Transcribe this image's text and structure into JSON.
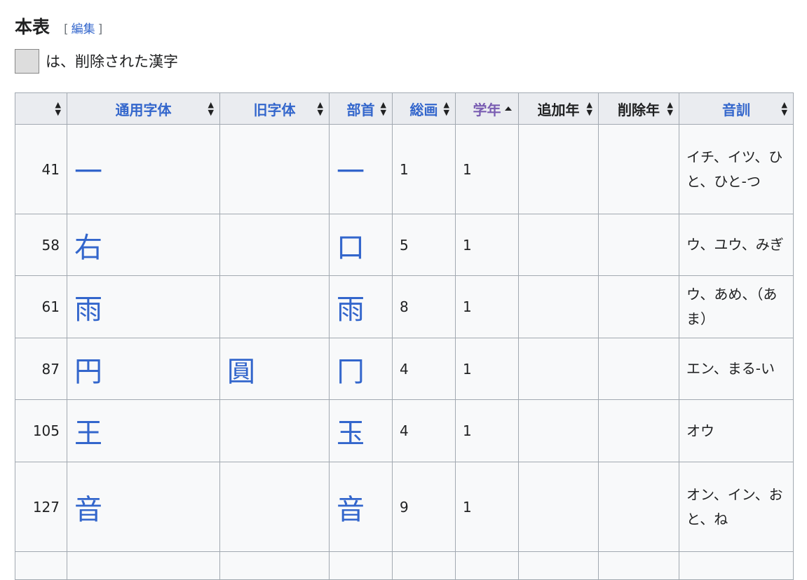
{
  "section": {
    "title": "本表",
    "edit_open": "[",
    "edit_label": "編集",
    "edit_close": "]"
  },
  "legend": {
    "text": "は、削除された漢字",
    "swatch_color": "#dddddd"
  },
  "table": {
    "columns": [
      {
        "label": "",
        "style": "none"
      },
      {
        "label": "通用字体",
        "style": "link"
      },
      {
        "label": "旧字体",
        "style": "link"
      },
      {
        "label": "部首",
        "style": "link"
      },
      {
        "label": "総画",
        "style": "link"
      },
      {
        "label": "学年",
        "style": "visited",
        "sorted": "ascending"
      },
      {
        "label": "追加年",
        "style": "plain"
      },
      {
        "label": "削除年",
        "style": "plain"
      },
      {
        "label": "音訓",
        "style": "link"
      }
    ],
    "rows": [
      {
        "no": "41",
        "kanji": "一",
        "old": "",
        "radical": "一",
        "strokes": "1",
        "grade": "1",
        "added": "",
        "removed": "",
        "reading": "イチ、イツ、ひと、ひと-つ"
      },
      {
        "no": "58",
        "kanji": "右",
        "old": "",
        "radical": "口",
        "strokes": "5",
        "grade": "1",
        "added": "",
        "removed": "",
        "reading": "ウ、ユウ、みぎ"
      },
      {
        "no": "61",
        "kanji": "雨",
        "old": "",
        "radical": "雨",
        "strokes": "8",
        "grade": "1",
        "added": "",
        "removed": "",
        "reading": "ウ、あめ、（あま）"
      },
      {
        "no": "87",
        "kanji": "円",
        "old": "圓",
        "radical": "冂",
        "strokes": "4",
        "grade": "1",
        "added": "",
        "removed": "",
        "reading": "エン、まる-い"
      },
      {
        "no": "105",
        "kanji": "王",
        "old": "",
        "radical": "玉",
        "strokes": "4",
        "grade": "1",
        "added": "",
        "removed": "",
        "reading": "オウ"
      },
      {
        "no": "127",
        "kanji": "音",
        "old": "",
        "radical": "音",
        "strokes": "9",
        "grade": "1",
        "added": "",
        "removed": "",
        "reading": "オン、イン、おと、ね"
      }
    ]
  },
  "colors": {
    "link": "#3366cc",
    "visited": "#795cb2",
    "header_bg": "#eaecf0",
    "cell_bg": "#f8f9fa",
    "border": "#a2a9b1"
  }
}
